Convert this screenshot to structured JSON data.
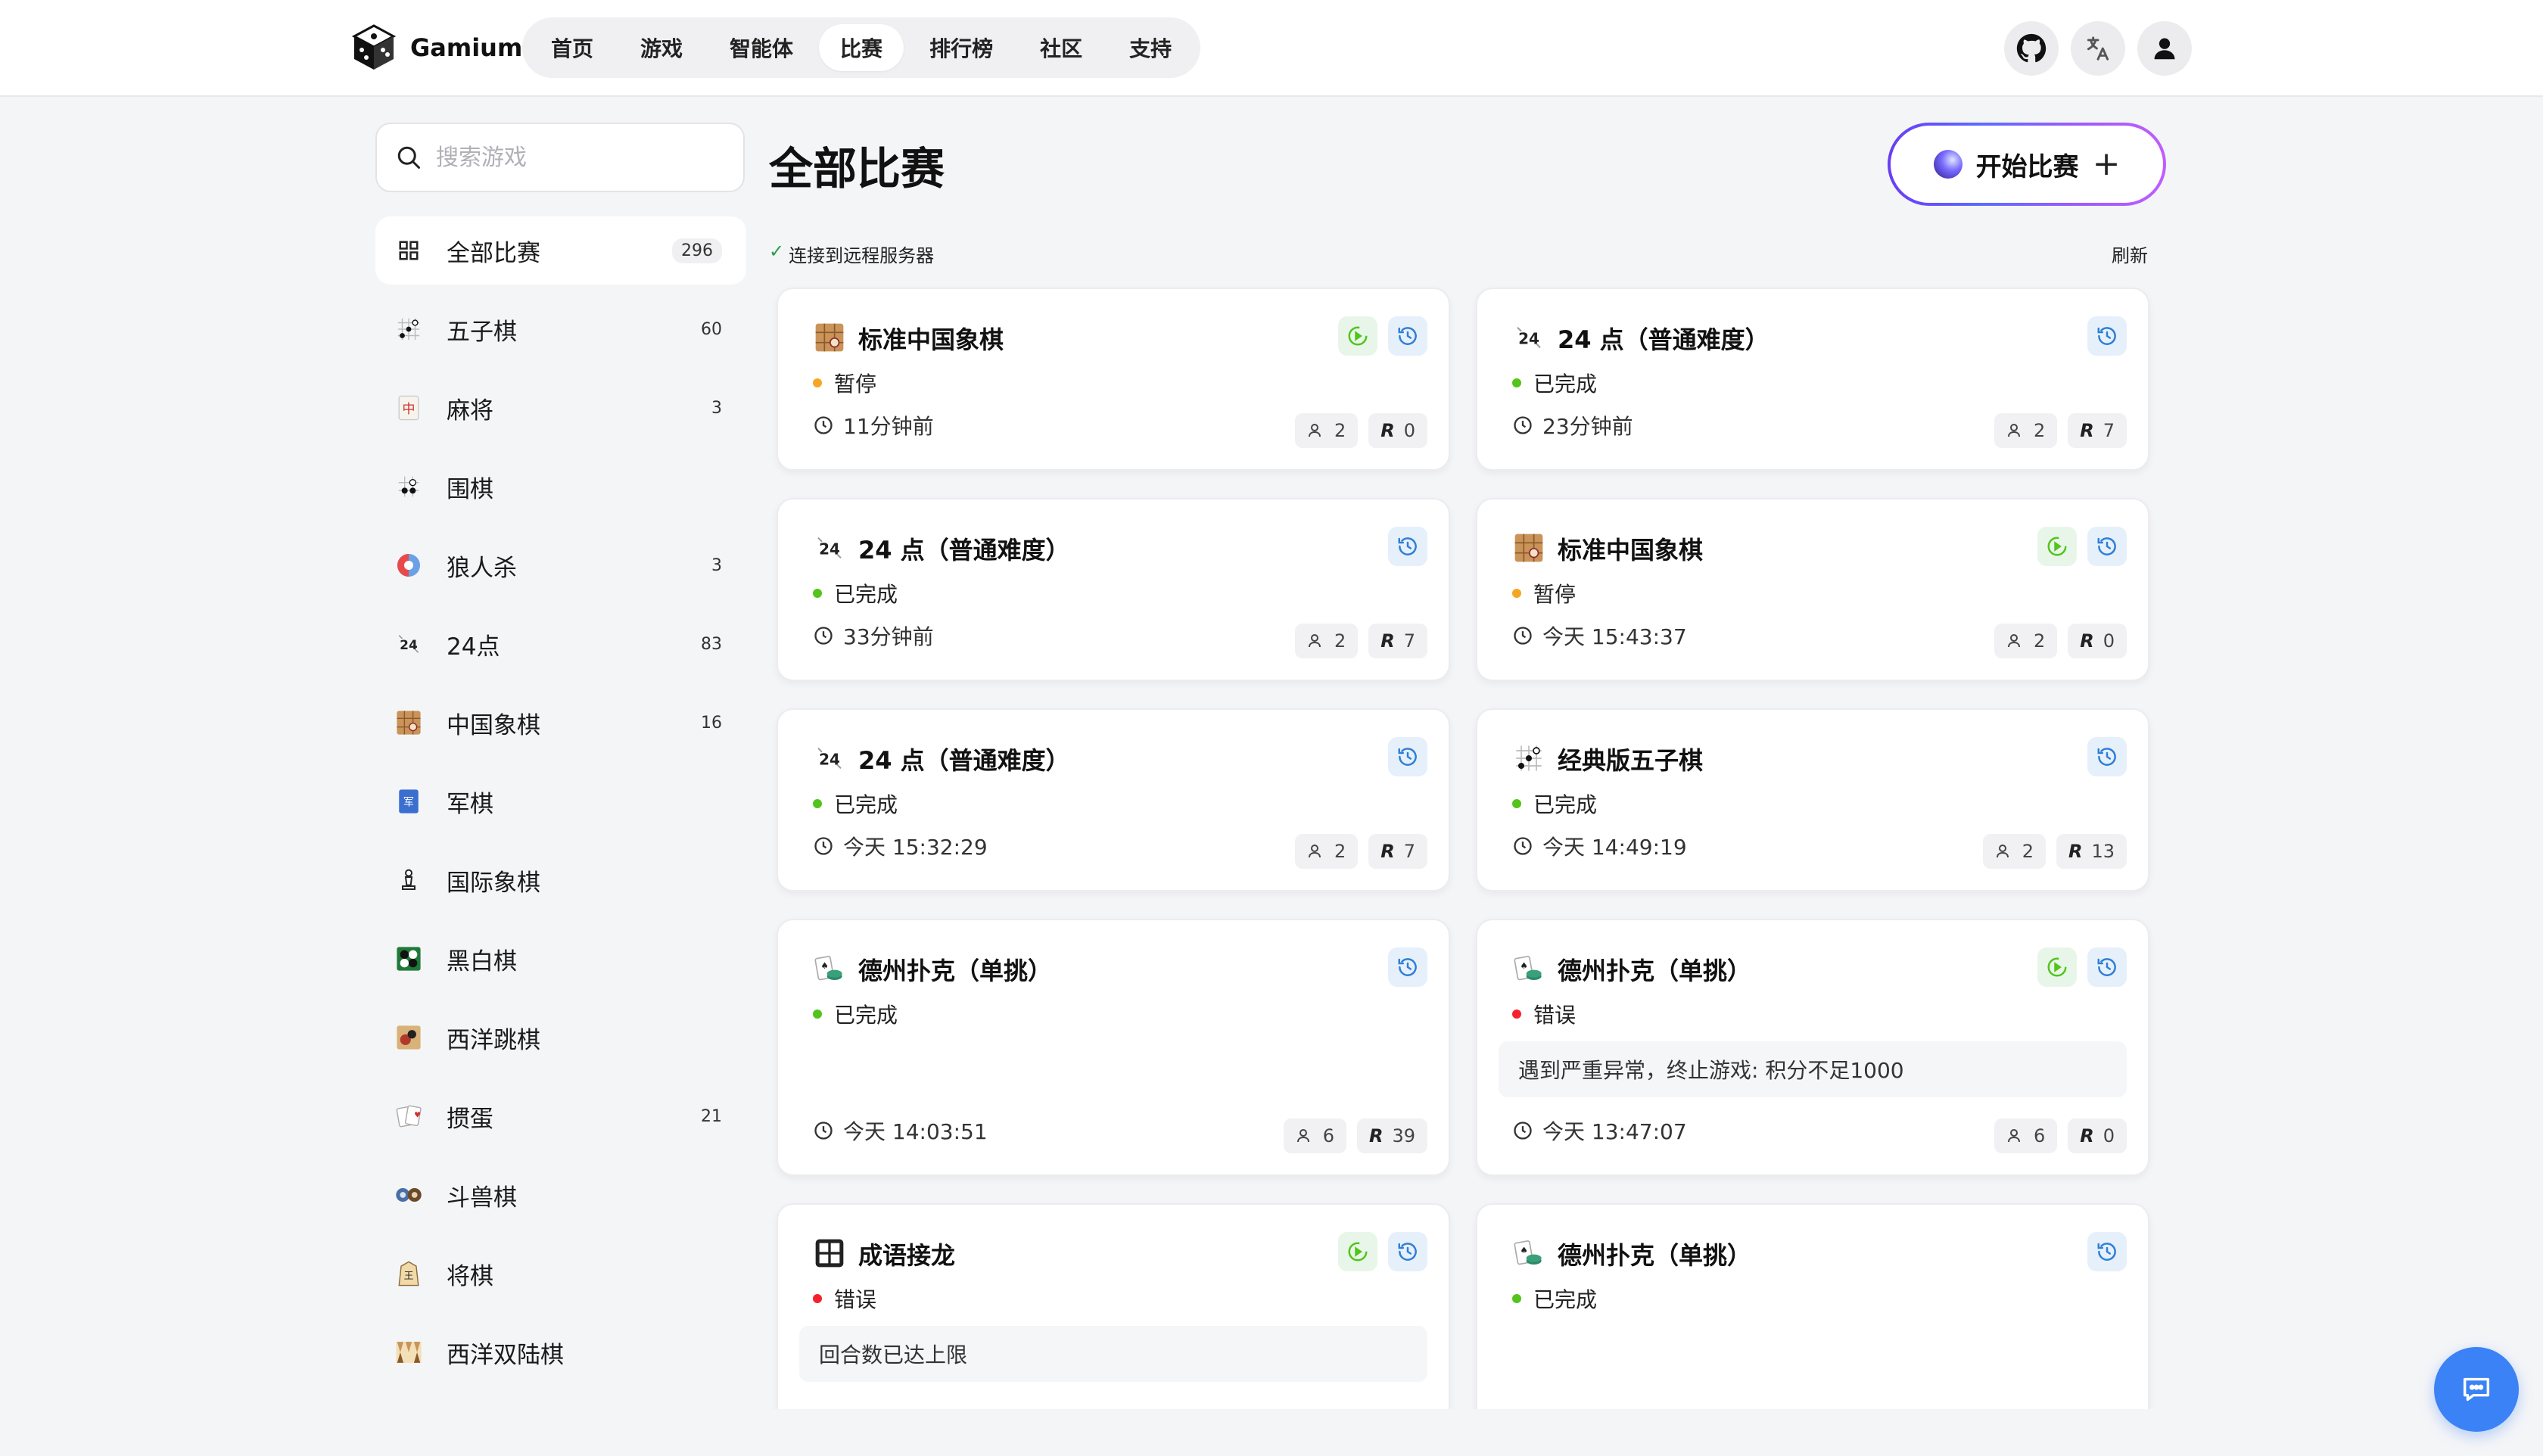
{
  "app": {
    "name": "Gamium"
  },
  "nav": {
    "items": [
      {
        "label": "首页",
        "active": false
      },
      {
        "label": "游戏",
        "active": false
      },
      {
        "label": "智能体",
        "active": false
      },
      {
        "label": "比赛",
        "active": true
      },
      {
        "label": "排行榜",
        "active": false
      },
      {
        "label": "社区",
        "active": false
      },
      {
        "label": "支持",
        "active": false
      }
    ],
    "right_buttons": [
      "github-icon",
      "translate-icon",
      "user-icon"
    ]
  },
  "search": {
    "placeholder": "搜索游戏",
    "value": ""
  },
  "sidebar": {
    "items": [
      {
        "label": "全部比赛",
        "count": "296",
        "icon": "grid-icon",
        "active": true
      },
      {
        "label": "五子棋",
        "count": "60",
        "icon": "gomoku-icon"
      },
      {
        "label": "麻将",
        "count": "3",
        "icon": "mahjong-icon"
      },
      {
        "label": "围棋",
        "count": "",
        "icon": "go-icon"
      },
      {
        "label": "狼人杀",
        "count": "3",
        "icon": "werewolf-icon"
      },
      {
        "label": "24点",
        "count": "83",
        "icon": "24-points-icon"
      },
      {
        "label": "中国象棋",
        "count": "16",
        "icon": "xiangqi-icon"
      },
      {
        "label": "军棋",
        "count": "",
        "icon": "junqi-icon"
      },
      {
        "label": "国际象棋",
        "count": "",
        "icon": "chess-icon"
      },
      {
        "label": "黑白棋",
        "count": "",
        "icon": "othello-icon"
      },
      {
        "label": "西洋跳棋",
        "count": "",
        "icon": "checkers-icon"
      },
      {
        "label": "掼蛋",
        "count": "21",
        "icon": "guandan-icon"
      },
      {
        "label": "斗兽棋",
        "count": "",
        "icon": "animal-chess-icon"
      },
      {
        "label": "将棋",
        "count": "",
        "icon": "shogi-icon"
      },
      {
        "label": "西洋双陆棋",
        "count": "",
        "icon": "backgammon-icon"
      }
    ]
  },
  "main": {
    "title": "全部比赛",
    "start_button": "开始比赛",
    "plus": "+",
    "connection": {
      "check": "✓",
      "text": "连接到远程服务器"
    },
    "refresh": "刷新",
    "matches": [
      {
        "title": "标准中国象棋",
        "icon": "xiangqi-icon",
        "status": "暂停",
        "status_color": "#f5a623",
        "time": "11分钟前",
        "players": "2",
        "rounds": "0",
        "play": true
      },
      {
        "title": "24 点（普通难度）",
        "icon": "24-points-icon",
        "status": "已完成",
        "status_color": "#52c41a",
        "time": "23分钟前",
        "players": "2",
        "rounds": "7",
        "play": false
      },
      {
        "title": "24 点（普通难度）",
        "icon": "24-points-icon",
        "status": "已完成",
        "status_color": "#52c41a",
        "time": "33分钟前",
        "players": "2",
        "rounds": "7",
        "play": false
      },
      {
        "title": "标准中国象棋",
        "icon": "xiangqi-icon",
        "status": "暂停",
        "status_color": "#f5a623",
        "time": "今天 15:43:37",
        "players": "2",
        "rounds": "0",
        "play": true
      },
      {
        "title": "24 点（普通难度）",
        "icon": "24-points-icon",
        "status": "已完成",
        "status_color": "#52c41a",
        "time": "今天 15:32:29",
        "players": "2",
        "rounds": "7",
        "play": false
      },
      {
        "title": "经典版五子棋",
        "icon": "gomoku-icon",
        "status": "已完成",
        "status_color": "#52c41a",
        "time": "今天 14:49:19",
        "players": "2",
        "rounds": "13",
        "play": false
      },
      {
        "title": "德州扑克（单挑）",
        "icon": "poker-icon",
        "status": "已完成",
        "status_color": "#52c41a",
        "time": "今天 14:03:51",
        "players": "6",
        "rounds": "39",
        "play": false
      },
      {
        "title": "德州扑克（单挑）",
        "icon": "poker-icon",
        "status": "错误",
        "status_color": "#f5222d",
        "message": "遇到严重异常，终止游戏: 积分不足1000",
        "time": "今天 13:47:07",
        "players": "6",
        "rounds": "0",
        "play": true
      },
      {
        "title": "成语接龙",
        "icon": "idiom-icon",
        "status": "错误",
        "status_color": "#f5222d",
        "message": "回合数已达上限",
        "time": "",
        "players": "",
        "rounds": "",
        "play": true
      },
      {
        "title": "德州扑克（单挑）",
        "icon": "poker-icon",
        "status": "已完成",
        "status_color": "#52c41a",
        "time": "",
        "players": "",
        "rounds": "",
        "play": false
      }
    ]
  },
  "colors": {
    "accent": "#3b82f6",
    "play_green": "#52c41a",
    "history_blue": "#2f7fd6"
  }
}
